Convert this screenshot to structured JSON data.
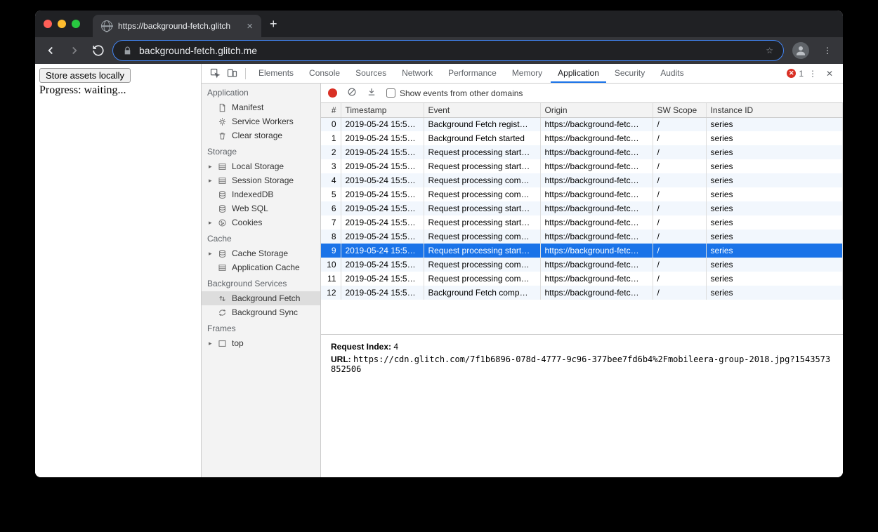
{
  "window": {
    "tab_title": "https://background-fetch.glitch",
    "url": "background-fetch.glitch.me"
  },
  "page": {
    "button_label": "Store assets locally",
    "progress_text": "Progress: waiting..."
  },
  "devtools": {
    "tabs": [
      "Elements",
      "Console",
      "Sources",
      "Network",
      "Performance",
      "Memory",
      "Application",
      "Security",
      "Audits"
    ],
    "active_tab": "Application",
    "error_count": "1"
  },
  "sidebar": {
    "sections": [
      {
        "title": "Application",
        "items": [
          {
            "label": "Manifest",
            "icon": "file"
          },
          {
            "label": "Service Workers",
            "icon": "gear"
          },
          {
            "label": "Clear storage",
            "icon": "trash"
          }
        ]
      },
      {
        "title": "Storage",
        "items": [
          {
            "label": "Local Storage",
            "icon": "db",
            "expandable": true
          },
          {
            "label": "Session Storage",
            "icon": "db",
            "expandable": true
          },
          {
            "label": "IndexedDB",
            "icon": "stack"
          },
          {
            "label": "Web SQL",
            "icon": "stack"
          },
          {
            "label": "Cookies",
            "icon": "cookie",
            "expandable": true
          }
        ]
      },
      {
        "title": "Cache",
        "items": [
          {
            "label": "Cache Storage",
            "icon": "stack",
            "expandable": true
          },
          {
            "label": "Application Cache",
            "icon": "db"
          }
        ]
      },
      {
        "title": "Background Services",
        "items": [
          {
            "label": "Background Fetch",
            "icon": "updown",
            "selected": true
          },
          {
            "label": "Background Sync",
            "icon": "sync"
          }
        ]
      },
      {
        "title": "Frames",
        "items": [
          {
            "label": "top",
            "icon": "frame",
            "expandable": true
          }
        ]
      }
    ]
  },
  "panel": {
    "checkbox_label": "Show events from other domains",
    "columns": [
      "#",
      "Timestamp",
      "Event",
      "Origin",
      "SW Scope",
      "Instance ID"
    ],
    "rows": [
      {
        "n": "0",
        "ts": "2019-05-24 15:5…",
        "ev": "Background Fetch regist…",
        "or": "https://background-fetc…",
        "sw": "/",
        "id": "series"
      },
      {
        "n": "1",
        "ts": "2019-05-24 15:5…",
        "ev": "Background Fetch started",
        "or": "https://background-fetc…",
        "sw": "/",
        "id": "series"
      },
      {
        "n": "2",
        "ts": "2019-05-24 15:5…",
        "ev": "Request processing start…",
        "or": "https://background-fetc…",
        "sw": "/",
        "id": "series"
      },
      {
        "n": "3",
        "ts": "2019-05-24 15:5…",
        "ev": "Request processing start…",
        "or": "https://background-fetc…",
        "sw": "/",
        "id": "series"
      },
      {
        "n": "4",
        "ts": "2019-05-24 15:5…",
        "ev": "Request processing com…",
        "or": "https://background-fetc…",
        "sw": "/",
        "id": "series"
      },
      {
        "n": "5",
        "ts": "2019-05-24 15:5…",
        "ev": "Request processing com…",
        "or": "https://background-fetc…",
        "sw": "/",
        "id": "series"
      },
      {
        "n": "6",
        "ts": "2019-05-24 15:5…",
        "ev": "Request processing start…",
        "or": "https://background-fetc…",
        "sw": "/",
        "id": "series"
      },
      {
        "n": "7",
        "ts": "2019-05-24 15:5…",
        "ev": "Request processing start…",
        "or": "https://background-fetc…",
        "sw": "/",
        "id": "series"
      },
      {
        "n": "8",
        "ts": "2019-05-24 15:5…",
        "ev": "Request processing com…",
        "or": "https://background-fetc…",
        "sw": "/",
        "id": "series"
      },
      {
        "n": "9",
        "ts": "2019-05-24 15:5…",
        "ev": "Request processing start…",
        "or": "https://background-fetc…",
        "sw": "/",
        "id": "series",
        "selected": true
      },
      {
        "n": "10",
        "ts": "2019-05-24 15:5…",
        "ev": "Request processing com…",
        "or": "https://background-fetc…",
        "sw": "/",
        "id": "series"
      },
      {
        "n": "11",
        "ts": "2019-05-24 15:5…",
        "ev": "Request processing com…",
        "or": "https://background-fetc…",
        "sw": "/",
        "id": "series"
      },
      {
        "n": "12",
        "ts": "2019-05-24 15:5…",
        "ev": "Background Fetch comp…",
        "or": "https://background-fetc…",
        "sw": "/",
        "id": "series"
      }
    ],
    "details": {
      "request_index_label": "Request Index:",
      "request_index_value": "4",
      "url_label": "URL:",
      "url_value": "https://cdn.glitch.com/7f1b6896-078d-4777-9c96-377bee7fd6b4%2Fmobileera-group-2018.jpg?1543573852506"
    }
  }
}
